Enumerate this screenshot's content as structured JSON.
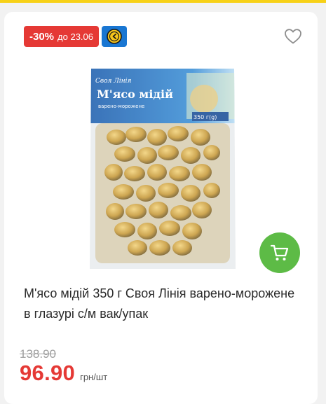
{
  "promo": {
    "discount": "-30%",
    "until": "до 23.06",
    "icon": "promo-coin-icon",
    "color_discount": "#e53935",
    "color_icon_bg": "#1976d2"
  },
  "favorite": {
    "icon": "heart-outline-icon"
  },
  "product": {
    "image_brand": "Своя Лінія",
    "image_title": "М'ясо мідій",
    "image_subtitle": "варено-морожене",
    "image_weight": "350 г(g)",
    "title": "М'ясо мідій 350 г Своя Лінія варено-мороженe в глазурі с/м вак/упак"
  },
  "price": {
    "old": "138.90",
    "current": "96.90",
    "unit": "грн/шт",
    "color_current": "#e53935"
  },
  "cart": {
    "icon": "cart-icon",
    "color": "#5dbb46"
  },
  "accent_color": "#f7d117"
}
